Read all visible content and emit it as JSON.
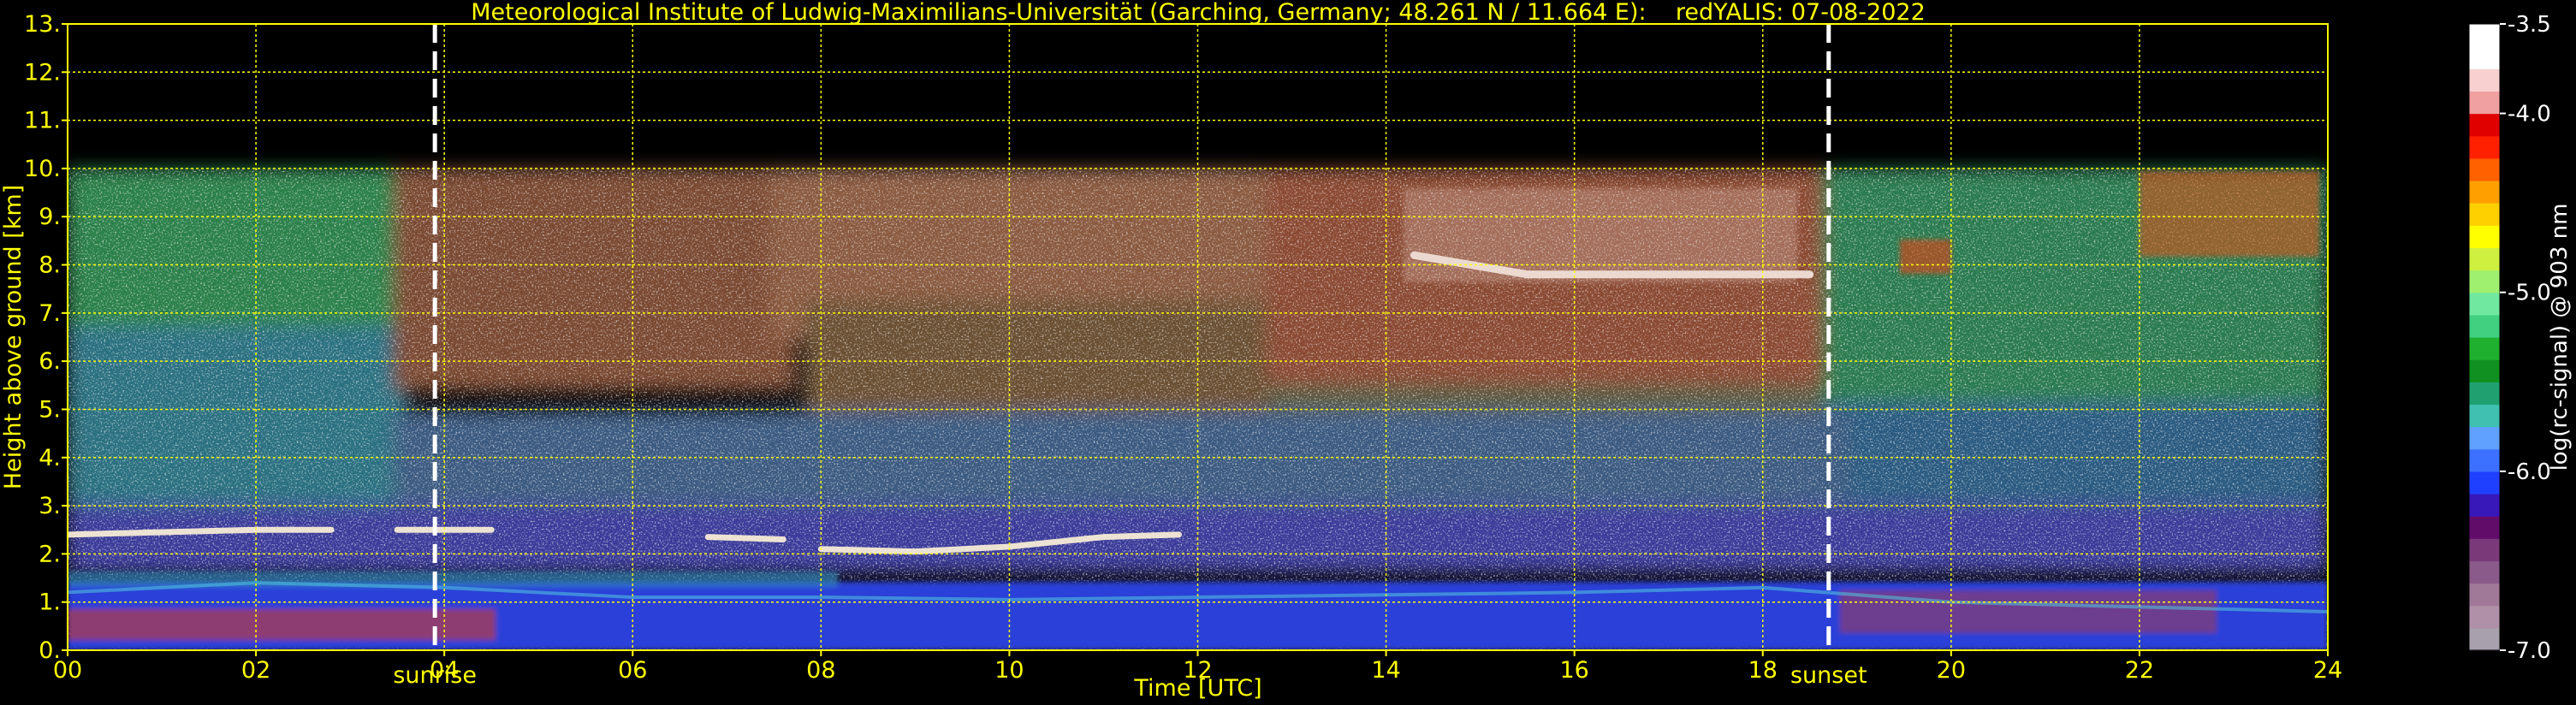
{
  "chart_data": {
    "type": "heatmap",
    "title": "Meteorological Institute of Ludwig-Maximilians-Universität (Garching, Germany; 48.261 N / 11.664 E):    redYALIS: 07-08-2022",
    "xlabel": "Time [UTC]",
    "ylabel": "Height above ground [km]",
    "xlim": [
      0,
      24
    ],
    "ylim": [
      0,
      13
    ],
    "x_ticks": [
      0,
      2,
      4,
      6,
      8,
      10,
      12,
      14,
      16,
      18,
      20,
      22,
      24
    ],
    "x_tick_labels": [
      "00",
      "02",
      "04",
      "06",
      "08",
      "10",
      "12",
      "14",
      "16",
      "18",
      "20",
      "22",
      "24"
    ],
    "y_ticks": [
      0,
      1,
      2,
      3,
      4,
      5,
      6,
      7,
      8,
      9,
      10,
      11,
      12,
      13
    ],
    "y_tick_labels": [
      "0.",
      "1.",
      "2.",
      "3.",
      "4.",
      "5.",
      "6.",
      "7.",
      "8.",
      "9.",
      "10.",
      "11.",
      "12.",
      "13."
    ],
    "grid": true,
    "grid_color": "#ffff00",
    "measurement_top_km": 10,
    "events": [
      {
        "label": "sunrise",
        "x": 3.9
      },
      {
        "label": "sunset",
        "x": 18.7
      }
    ],
    "colorbar": {
      "label": "log(rc-signal) @ 903 nm",
      "range": [
        -7.0,
        -3.5
      ],
      "tick_values": [
        -3.5,
        -4.0,
        -5.0,
        -6.0,
        -7.0
      ],
      "tick_labels": [
        "-3.5",
        "-4.0",
        "-5.0",
        "-6.0",
        "-7.0"
      ],
      "colors": [
        "#a8a0ac",
        "#b090a8",
        "#a07898",
        "#8a5a8a",
        "#7a3a7a",
        "#620c6a",
        "#3818b8",
        "#2040ff",
        "#3c70ff",
        "#60a0ff",
        "#40c0b0",
        "#20a070",
        "#109020",
        "#20b030",
        "#40d080",
        "#70e8a0",
        "#a0f070",
        "#d0f040",
        "#ffff00",
        "#ffd000",
        "#ffa000",
        "#ff6000",
        "#ff2000",
        "#e00000",
        "#f0a0a0",
        "#f8d0d0",
        "#ffffff",
        "#ffffff"
      ]
    },
    "features": [
      {
        "name": "cloud layer",
        "x": [
          0.0,
          2.0,
          2.8
        ],
        "y": [
          2.4,
          2.5,
          2.5
        ]
      },
      {
        "name": "cloud layer",
        "x": [
          3.5,
          4.5
        ],
        "y": [
          2.5,
          2.5
        ]
      },
      {
        "name": "cloud layer",
        "x": [
          6.8,
          7.6
        ],
        "y": [
          2.35,
          2.3
        ]
      },
      {
        "name": "cloud layer",
        "x": [
          8.0,
          9.0,
          10.0,
          11.0,
          11.8
        ],
        "y": [
          2.1,
          2.05,
          2.15,
          2.35,
          2.4
        ]
      },
      {
        "name": "cirrus",
        "x": [
          14.3,
          15.5,
          17.0,
          18.5
        ],
        "y": [
          8.2,
          7.8,
          7.8,
          7.8
        ]
      },
      {
        "name": "boundary layer top",
        "x": [
          0,
          2,
          4,
          6,
          8,
          10,
          12,
          14,
          16,
          18,
          20,
          22,
          24
        ],
        "y": [
          1.2,
          1.4,
          1.3,
          1.1,
          1.1,
          1.05,
          1.1,
          1.15,
          1.2,
          1.3,
          1.0,
          0.9,
          0.8
        ]
      }
    ]
  }
}
